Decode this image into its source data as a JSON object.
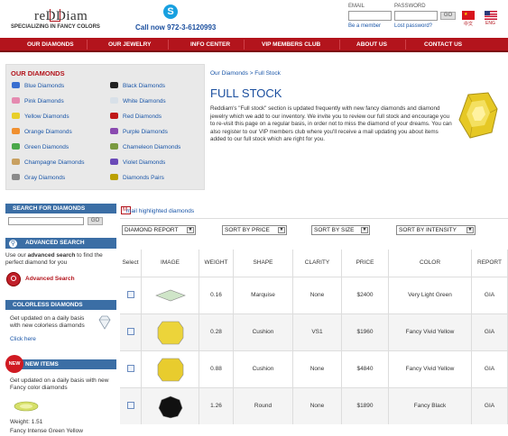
{
  "header": {
    "logo_text": "reDDiam",
    "logo_tagline": "SPECIALIZING IN FANCY COLORS",
    "phone": "Call now 972-3-6120993",
    "email_label": "EMAIL",
    "password_label": "PASSWORD",
    "go": "GO",
    "be_member": "Be a member",
    "lost_password": "Lost password?",
    "flag_cn": "中文",
    "flag_en": "ENG"
  },
  "nav": [
    "OUR DIAMONDS",
    "OUR JEWELRY",
    "INFO CENTER",
    "VIP MEMBERS CLUB",
    "ABOUT US",
    "CONTACT US"
  ],
  "categories": {
    "title": "OUR DIAMONDS",
    "left": [
      "Blue Diamonds",
      "Pink Diamonds",
      "Yellow Diamonds",
      "Orange Diamonds",
      "Green Diamonds",
      "Champagne Diamonds",
      "Gray Diamonds"
    ],
    "right": [
      "Black Diamonds",
      "White Diamonds",
      "Red Diamonds",
      "Purple Diamonds",
      "Chameleon Diamonds",
      "Violet Diamonds",
      "Diamonds Pairs"
    ],
    "left_colors": [
      "#3a6fd0",
      "#e58ab0",
      "#e8cf2a",
      "#f09030",
      "#4aa84a",
      "#c8a060",
      "#8a8a8a"
    ],
    "right_colors": [
      "#222222",
      "#d8e0e8",
      "#c01818",
      "#8a4ab0",
      "#7a9a40",
      "#6a4ab8",
      "#bba000"
    ]
  },
  "content": {
    "breadcrumb": "Our Diamonds > Full Stock",
    "title": "FULL STOCK",
    "paragraph": "Reddiam's \"Full stock\" section is updated frequently with new fancy diamonds and diamond jewelry which we add to our inventory. We invite you to review our full stock and encourage you to re-visit this page on a regular basis, in order not to miss the diamond of your dreams. You can also register to our VIP members club where you'll receive a mail updating you about items added to our full stock which are right for you."
  },
  "sidebar": {
    "search_title": "SEARCH FOR DIAMONDS",
    "go": "GO",
    "adv_title": "ADVANCED SEARCH",
    "adv_text_1": "Use our",
    "adv_text_bold": "advanced search",
    "adv_text_2": "to find the perfect diamond for you",
    "adv_link": "Advanced Search",
    "colorless_title": "COLORLESS DIAMONDS",
    "colorless_text": "Get updated on a daily basis with new colorless diamonds",
    "click_here": "Click here",
    "new_badge": "NEW",
    "new_title": "NEW ITEMS",
    "new_text": "Get updated on a daily basis with new Fancy color diamonds",
    "weight": "Weight: 1.51",
    "color": "Fancy Intense Green Yellow"
  },
  "mail_highlighted": "mail highlighted diamonds",
  "sorts": [
    "DIAMOND REPORT",
    "SORT BY PRICE",
    "SORT BY SIZE",
    "SORT BY INTENSITY"
  ],
  "table": {
    "headers": [
      "Select",
      "IMAGE",
      "WEIGHT",
      "SHAPE",
      "CLARITY",
      "PRICE",
      "COLOR",
      "REPORT"
    ],
    "rows": [
      {
        "weight": "0.16",
        "shape": "Marquise",
        "clarity": "None",
        "price": "$2400",
        "color": "Very Light Green",
        "report": "GIA",
        "gem": "#cfe5c8"
      },
      {
        "weight": "0.28",
        "shape": "Cushion",
        "clarity": "VS1",
        "price": "$1960",
        "color": "Fancy Vivid Yellow",
        "report": "GIA",
        "gem": "#ecd43a"
      },
      {
        "weight": "0.88",
        "shape": "Cushion",
        "clarity": "None",
        "price": "$4840",
        "color": "Fancy Vivid Yellow",
        "report": "GIA",
        "gem": "#e8cc2e"
      },
      {
        "weight": "1.26",
        "shape": "Round",
        "clarity": "None",
        "price": "$1890",
        "color": "Fancy Black",
        "report": "GIA",
        "gem": "#111111"
      }
    ]
  }
}
